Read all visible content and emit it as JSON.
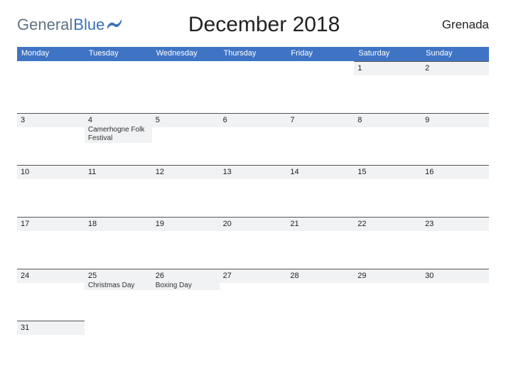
{
  "brand": {
    "general": "General",
    "blue": "Blue"
  },
  "title": "December 2018",
  "region": "Grenada",
  "dow": [
    "Monday",
    "Tuesday",
    "Wednesday",
    "Thursday",
    "Friday",
    "Saturday",
    "Sunday"
  ],
  "weeks": [
    [
      {
        "num": "",
        "event": "",
        "lead": true
      },
      {
        "num": "",
        "event": "",
        "lead": true
      },
      {
        "num": "",
        "event": "",
        "lead": true
      },
      {
        "num": "",
        "event": "",
        "lead": true
      },
      {
        "num": "",
        "event": "",
        "lead": true
      },
      {
        "num": "1",
        "event": ""
      },
      {
        "num": "2",
        "event": ""
      }
    ],
    [
      {
        "num": "3",
        "event": ""
      },
      {
        "num": "4",
        "event": "Camerhogne Folk Festival"
      },
      {
        "num": "5",
        "event": ""
      },
      {
        "num": "6",
        "event": ""
      },
      {
        "num": "7",
        "event": ""
      },
      {
        "num": "8",
        "event": ""
      },
      {
        "num": "9",
        "event": ""
      }
    ],
    [
      {
        "num": "10",
        "event": ""
      },
      {
        "num": "11",
        "event": ""
      },
      {
        "num": "12",
        "event": ""
      },
      {
        "num": "13",
        "event": ""
      },
      {
        "num": "14",
        "event": ""
      },
      {
        "num": "15",
        "event": ""
      },
      {
        "num": "16",
        "event": ""
      }
    ],
    [
      {
        "num": "17",
        "event": ""
      },
      {
        "num": "18",
        "event": ""
      },
      {
        "num": "19",
        "event": ""
      },
      {
        "num": "20",
        "event": ""
      },
      {
        "num": "21",
        "event": ""
      },
      {
        "num": "22",
        "event": ""
      },
      {
        "num": "23",
        "event": ""
      }
    ],
    [
      {
        "num": "24",
        "event": ""
      },
      {
        "num": "25",
        "event": "Christmas Day"
      },
      {
        "num": "26",
        "event": "Boxing Day"
      },
      {
        "num": "27",
        "event": ""
      },
      {
        "num": "28",
        "event": ""
      },
      {
        "num": "29",
        "event": ""
      },
      {
        "num": "30",
        "event": ""
      }
    ],
    [
      {
        "num": "31",
        "event": ""
      },
      {
        "num": "",
        "event": "",
        "lead": true
      },
      {
        "num": "",
        "event": "",
        "lead": true
      },
      {
        "num": "",
        "event": "",
        "lead": true
      },
      {
        "num": "",
        "event": "",
        "lead": true
      },
      {
        "num": "",
        "event": "",
        "lead": true
      },
      {
        "num": "",
        "event": "",
        "lead": true
      }
    ]
  ]
}
